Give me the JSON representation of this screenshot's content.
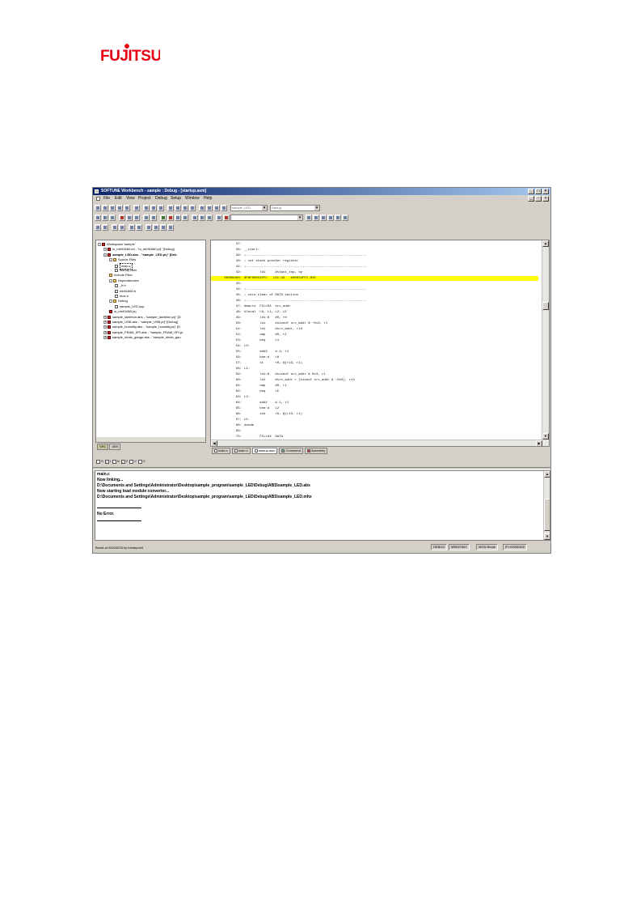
{
  "logo": {
    "text": "FUJITSU",
    "color": "#e60012"
  },
  "window": {
    "title": "SOFTUNE Workbench - sample : Debug - [startup.asm]",
    "caption_buttons": [
      "_",
      "□",
      "×"
    ],
    "mdi_buttons": [
      "_",
      "▫",
      "×"
    ]
  },
  "menu": [
    "File",
    "Edit",
    "View",
    "Project",
    "Debug",
    "Setup",
    "Window",
    "Help"
  ],
  "toolbar": {
    "combo_project": "sample_LED",
    "combo_config": "Debug"
  },
  "tree": {
    "items": [
      {
        "label": "Workspace 'sample'",
        "level": 0,
        "icon": "workspace",
        "expand": "-"
      },
      {
        "label": "io_mb91660.rel - \"io_mb91660.prj\" [Debug]",
        "level": 1,
        "icon": "project",
        "expand": "+"
      },
      {
        "label": "sample_LED.abs - \"sample_LED.prj\" [Deb",
        "level": 1,
        "icon": "project",
        "expand": "-",
        "bold": true
      },
      {
        "label": "Source Files",
        "level": 2,
        "icon": "folder",
        "expand": "-"
      },
      {
        "label": "main.c",
        "level": 3,
        "icon": "file",
        "selected": true
      },
      {
        "label": "startup.asm",
        "level": 3,
        "icon": "file"
      },
      {
        "label": "Include Files",
        "level": 2,
        "icon": "folder"
      },
      {
        "label": "Dependencies",
        "level": 2,
        "icon": "folder",
        "expand": "-"
      },
      {
        "label": "_fr.h",
        "level": 3,
        "icon": "file"
      },
      {
        "label": "mb91660.h",
        "level": 3,
        "icon": "file"
      },
      {
        "label": "mon.h",
        "level": 3,
        "icon": "file"
      },
      {
        "label": "Debug",
        "level": 2,
        "icon": "folder",
        "expand": "-"
      },
      {
        "label": "sample_LED.sup",
        "level": 3,
        "icon": "file"
      },
      {
        "label": "io_mb91660.prj",
        "level": 2,
        "icon": "project"
      },
      {
        "label": "sample_skeleton.abs - \"sample_skeleton.prj\" [D",
        "level": 1,
        "icon": "project",
        "expand": "+"
      },
      {
        "label": "sample_USB.abs - \"sample_USB.prj\" [Debug]",
        "level": 1,
        "icon": "project",
        "expand": "+"
      },
      {
        "label": "sample_humidity.abs - \"sample_humidity.prj\" [D",
        "level": 1,
        "icon": "project",
        "expand": "+"
      },
      {
        "label": "sample_FRAM_SPI.abs - \"sample_FRAM_SPI.pr",
        "level": 1,
        "icon": "project",
        "expand": "+"
      },
      {
        "label": "sample_strain_gauge.abs - \"sample_strain_gau",
        "level": 1,
        "icon": "project",
        "expand": "+"
      }
    ],
    "tabs": [
      "SRC",
      "ABS"
    ]
  },
  "code": {
    "lines": [
      {
        "n": "37:",
        "t": ""
      },
      {
        "n": "38:",
        "t": "__start:"
      },
      {
        "n": "39:",
        "t": ";--------------------------------------------------------------"
      },
      {
        "n": "40:",
        "t": "; set stack pointer register"
      },
      {
        "n": "41:",
        "t": ";--------------------------------------------------------------"
      },
      {
        "n": "42:",
        "t": "        ldi     #stack_top, sp"
      },
      {
        "n": "00000400:",
        "t": "9F8F00034FFC   LDI:32   #00034FFC,R15",
        "hl": true
      },
      {
        "n": "43:",
        "t": ""
      },
      {
        "n": "44:",
        "t": ";--------------------------------------------------------------"
      },
      {
        "n": "45:",
        "t": "; zero clear of DATA section"
      },
      {
        "n": "46:",
        "t": ";--------------------------------------------------------------"
      },
      {
        "n": "47:",
        "t": "#macro  FILL04  src_addr"
      },
      {
        "n": "48:",
        "t": "#local  L0, L1, L2, LE"
      },
      {
        "n": "49:",
        "t": "        ldi:8   #0, r0"
      },
      {
        "n": "50:",
        "t": "        ldi     #sizeof src_addr & ~0x3, r1"
      },
      {
        "n": "51:",
        "t": "        ldi     #src_addr, r13"
      },
      {
        "n": "52:",
        "t": "        cmp     #0, r1"
      },
      {
        "n": "53:",
        "t": "        beq     L1"
      },
      {
        "n": "54:",
        "t": "L0:"
      },
      {
        "n": "55:",
        "t": "        add2    #-4, r1"
      },
      {
        "n": "56:",
        "t": "        bne:d   L0"
      },
      {
        "n": "57:",
        "t": "        st      r0, @(r13, r1)"
      },
      {
        "n": "58:",
        "t": "L1:"
      },
      {
        "n": "59:",
        "t": "        ldi:8   #sizeof src_addr & 0x3, r1"
      },
      {
        "n": "60:",
        "t": "        ldi     #src_addr + (sizeof src_addr & ~0x3), r13"
      },
      {
        "n": "61:",
        "t": "        cmp     #0, r1"
      },
      {
        "n": "62:",
        "t": "        beq     LE"
      },
      {
        "n": "63:",
        "t": "L2:"
      },
      {
        "n": "64:",
        "t": "        add2    #-1, r1"
      },
      {
        "n": "65:",
        "t": "        bne:d   L2"
      },
      {
        "n": "66:",
        "t": "        stb     r0, @(r13, r1)"
      },
      {
        "n": "67:",
        "t": "LE:"
      },
      {
        "n": "68:",
        "t": "#endm"
      },
      {
        "n": "69:",
        "t": ""
      },
      {
        "n": "70:",
        "t": "        FILL04  DATA"
      }
    ],
    "tabs": [
      "main.c",
      "main.c",
      "startup.asm",
      "Command",
      "Assembly"
    ]
  },
  "flags": [
    "S",
    "I",
    "N",
    "Z",
    "V",
    "C"
  ],
  "flags_checked": [
    "I",
    "Z"
  ],
  "output": {
    "lines": [
      "main.c",
      "Now linking...",
      "D:\\Documents and Settings\\Administrator\\Desktop\\sample_program\\sample_LED\\Debug\\ABS\\sample_LED.abs",
      "Now starting load module converter...",
      "D:\\Documents and Settings\\Administrator\\Desktop\\sample_program\\sample_LED\\Debug\\ABS\\sample_LED.mhx",
      "No Error."
    ]
  },
  "status": {
    "message": "Break at 00034026 by breakpoint",
    "cells": [
      "DEBUG",
      "MB91F662",
      "MON Break",
      "IP=00000400"
    ]
  },
  "colors": {
    "highlight": "#ffff00",
    "title_start": "#0a246a",
    "title_end": "#a6caf0"
  }
}
